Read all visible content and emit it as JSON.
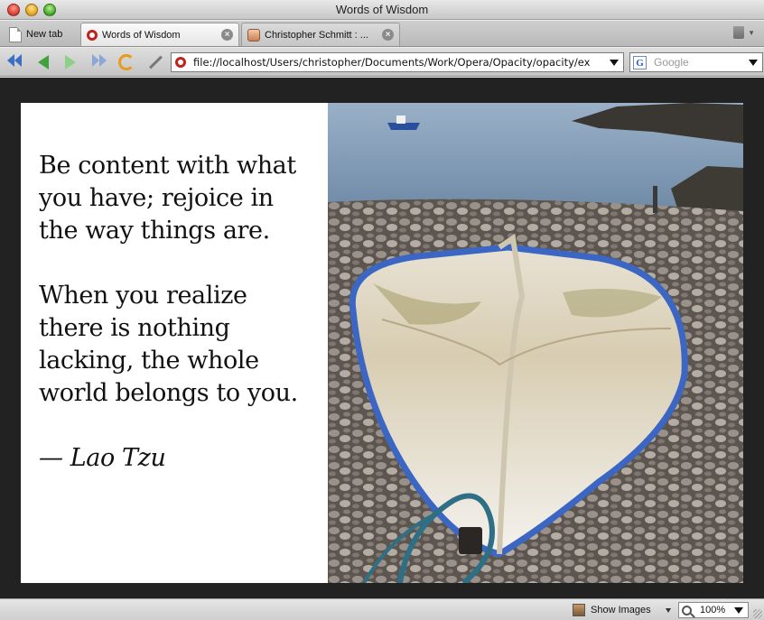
{
  "window": {
    "title": "Words of Wisdom"
  },
  "tabs": {
    "new_tab_label": "New tab",
    "items": [
      {
        "label": "Words of Wisdom",
        "active": true
      },
      {
        "label": "Christopher Schmitt : ...",
        "active": false
      }
    ]
  },
  "toolbar": {
    "address": "file://localhost/Users/christopher/Documents/Work/Opera/Opacity/opacity/ex",
    "search_placeholder": "Google"
  },
  "page": {
    "quote_1": "Be content with what you have; rejoice in the way things are.",
    "quote_2": "When you realize there is nothing lacking, the whole world belongs to you.",
    "author": "— Lao Tzu",
    "image_subject": "white rowboat on pebble beach"
  },
  "statusbar": {
    "show_images_label": "Show Images",
    "zoom": "100%"
  },
  "colors": {
    "page_background": "#222222",
    "panel_background": "#ffffff"
  }
}
